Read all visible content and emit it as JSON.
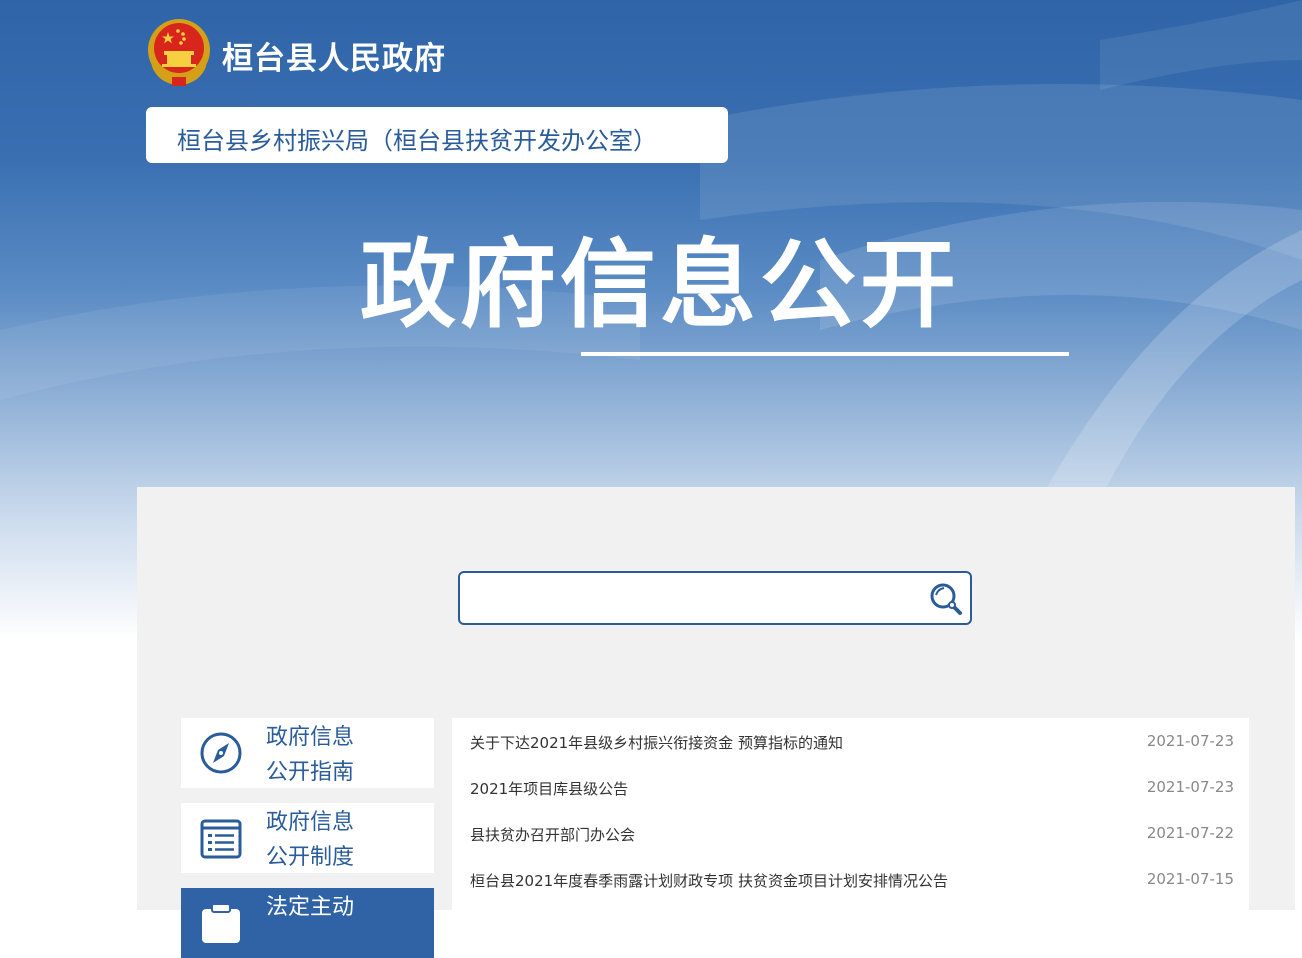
{
  "header": {
    "site_title": "桓台县人民政府",
    "department": "桓台县乡村振兴局（桓台县扶贫开发办公室）",
    "hero_title": "政府信息公开"
  },
  "search": {
    "value": "",
    "placeholder": ""
  },
  "sidebar": {
    "items": [
      {
        "line1": "政府信息",
        "line2": "公开指南",
        "icon": "compass-icon"
      },
      {
        "line1": "政府信息",
        "line2": "公开制度",
        "icon": "document-list-icon"
      },
      {
        "line1": "法定主动",
        "line2": "",
        "icon": "clipboard-icon"
      }
    ]
  },
  "news": {
    "items": [
      {
        "title": "关于下达2021年县级乡村振兴衔接资金 预算指标的通知",
        "date": "2021-07-23"
      },
      {
        "title": "2021年项目库县级公告",
        "date": "2021-07-23"
      },
      {
        "title": "县扶贫办召开部门办公会",
        "date": "2021-07-22"
      },
      {
        "title": "桓台县2021年度春季雨露计划财政专项 扶贫资金项目计划安排情况公告",
        "date": "2021-07-15"
      }
    ]
  },
  "colors": {
    "brand_blue": "#2a5c9a",
    "active_blue": "#2f63a5",
    "panel_bg": "#f1f1f1"
  }
}
